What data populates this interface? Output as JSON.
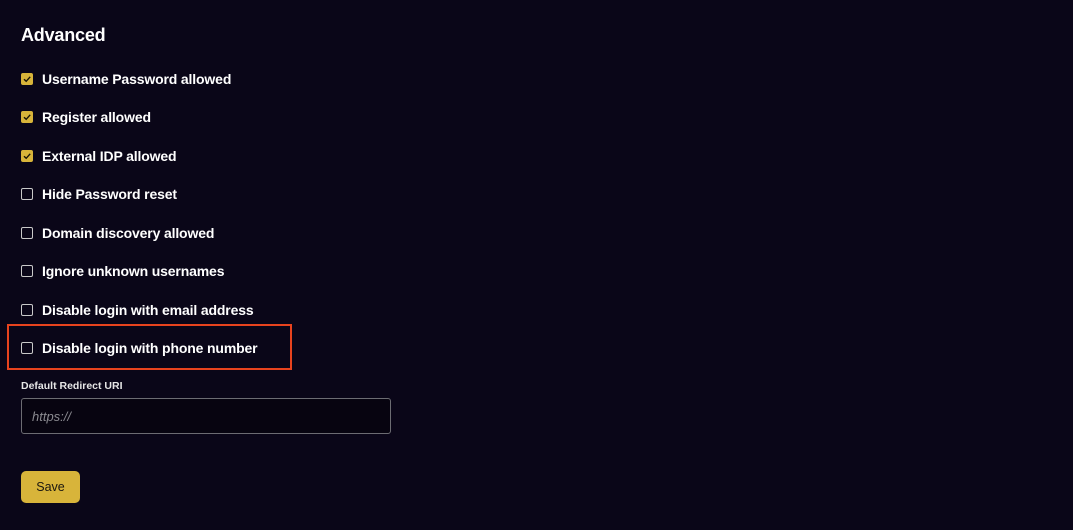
{
  "section": {
    "title": "Advanced"
  },
  "theme": {
    "accent": "#d8b43a",
    "background": "#0a0618",
    "highlight": "#e8431e"
  },
  "checkboxes": [
    {
      "label": "Username Password allowed",
      "checked": true
    },
    {
      "label": "Register allowed",
      "checked": true
    },
    {
      "label": "External IDP allowed",
      "checked": true
    },
    {
      "label": "Hide Password reset",
      "checked": false
    },
    {
      "label": "Domain discovery allowed",
      "checked": false
    },
    {
      "label": "Ignore unknown usernames",
      "checked": false
    },
    {
      "label": "Disable login with email address",
      "checked": false
    },
    {
      "label": "Disable login with phone number",
      "checked": false
    }
  ],
  "redirect": {
    "label": "Default Redirect URI",
    "value": "",
    "placeholder": "https://"
  },
  "actions": {
    "save_label": "Save"
  }
}
